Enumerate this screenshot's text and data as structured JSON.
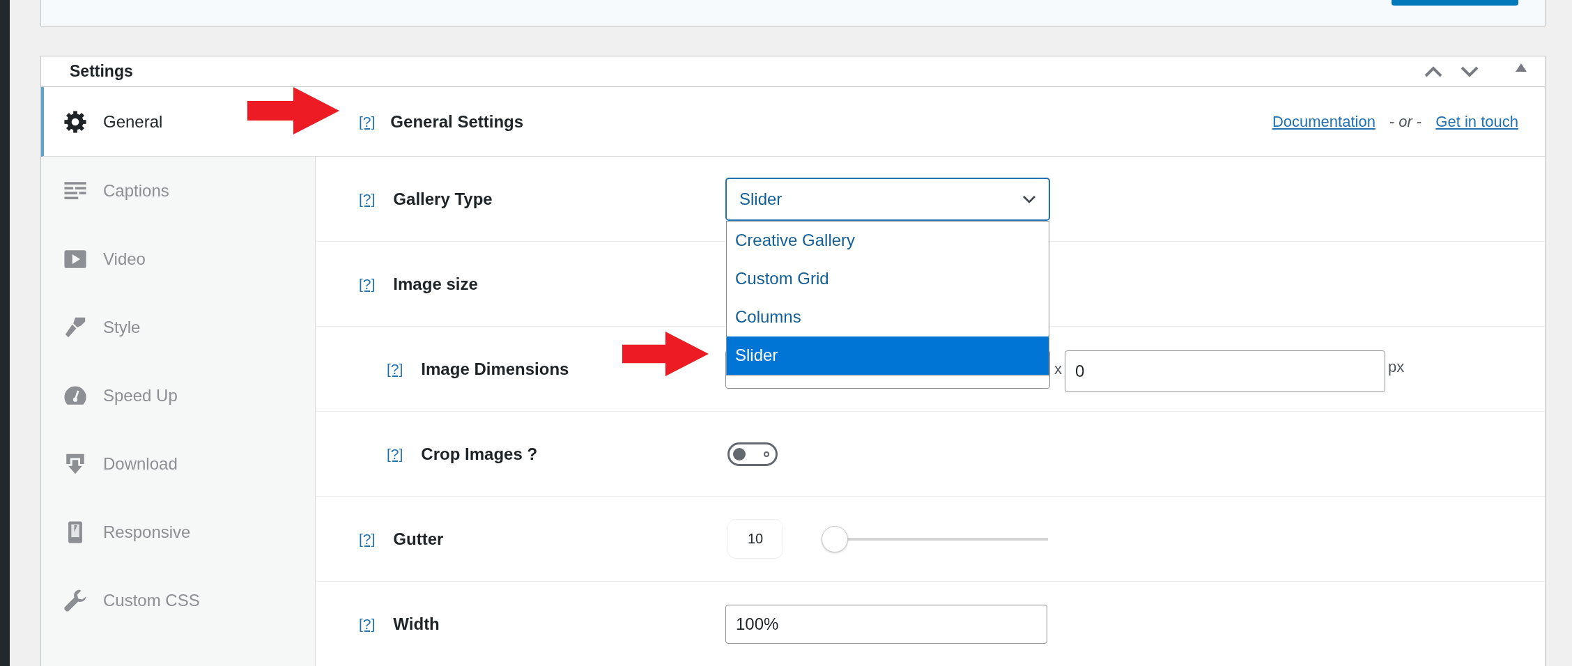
{
  "settings_panel": {
    "title": "Settings"
  },
  "sidebar": {
    "items": [
      {
        "label": "General",
        "kind": "gear",
        "selected": true
      },
      {
        "label": "Captions",
        "kind": "captions",
        "selected": false
      },
      {
        "label": "Video",
        "kind": "video",
        "selected": false
      },
      {
        "label": "Style",
        "kind": "brush",
        "selected": false
      },
      {
        "label": "Speed Up",
        "kind": "gauge",
        "selected": false
      },
      {
        "label": "Download",
        "kind": "download",
        "selected": false
      },
      {
        "label": "Responsive",
        "kind": "phone",
        "selected": false
      },
      {
        "label": "Custom CSS",
        "kind": "wrench",
        "selected": false
      }
    ]
  },
  "section": {
    "help": "[?]",
    "title": "General Settings",
    "arrow": true,
    "links": [
      {
        "label": "Documentation"
      },
      {
        "label": "Get in touch"
      }
    ],
    "separator": "- *or* -"
  },
  "fields": [
    {
      "kind": "select",
      "help": "[?]",
      "label": "Gallery Type",
      "value": "Slider",
      "expanded": true,
      "options": [
        {
          "label": "Creative Gallery",
          "selected": false,
          "arrow": false
        },
        {
          "label": "Custom Grid",
          "selected": false,
          "arrow": false
        },
        {
          "label": "Columns",
          "selected": false,
          "arrow": false
        },
        {
          "label": "Slider",
          "selected": true,
          "arrow": true
        }
      ]
    },
    {
      "kind": "heading",
      "help": "[?]",
      "label": "Image size",
      "children": [
        {
          "kind": "dimensions",
          "help": "[?]",
          "label": "Image Dimensions",
          "separator": "x",
          "height_value": "0",
          "unit": "px"
        },
        {
          "kind": "toggle",
          "help": "[?]",
          "label": "Crop Images ?",
          "on": false
        }
      ]
    },
    {
      "kind": "slider",
      "help": "[?]",
      "label": "Gutter",
      "value": "10",
      "level": 0
    },
    {
      "kind": "text",
      "help": "[?]",
      "label": "Width",
      "value": "100%"
    }
  ]
}
